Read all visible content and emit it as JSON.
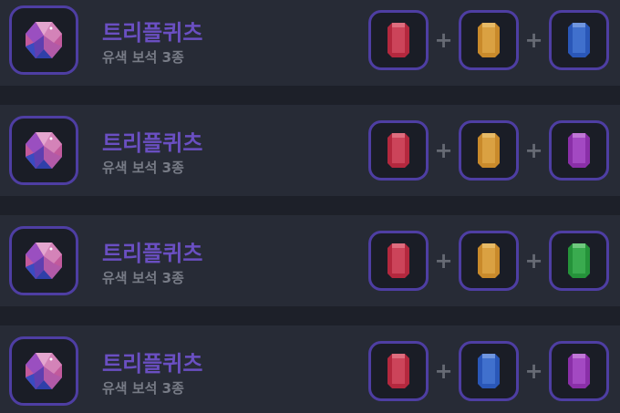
{
  "items": [
    {
      "name": "트리플퀴츠",
      "description": "유색 보석 3종",
      "icon": "triple-quartz-gem-icon",
      "ingredients": [
        {
          "icon": "red-gem-icon",
          "color": "#b4283e"
        },
        {
          "icon": "orange-gem-icon",
          "color": "#c98a2b"
        },
        {
          "icon": "blue-gem-icon",
          "color": "#2a57b8"
        }
      ]
    },
    {
      "name": "트리플퀴츠",
      "description": "유색 보석 3종",
      "icon": "triple-quartz-gem-icon",
      "ingredients": [
        {
          "icon": "red-gem-icon",
          "color": "#b4283e"
        },
        {
          "icon": "orange-gem-icon",
          "color": "#c98a2b"
        },
        {
          "icon": "purple-gem-icon",
          "color": "#8a2fa8"
        }
      ]
    },
    {
      "name": "트리플퀴츠",
      "description": "유색 보석 3종",
      "icon": "triple-quartz-gem-icon",
      "ingredients": [
        {
          "icon": "red-gem-icon",
          "color": "#b4283e"
        },
        {
          "icon": "orange-gem-icon",
          "color": "#c98a2b"
        },
        {
          "icon": "green-gem-icon",
          "color": "#25933a"
        }
      ]
    },
    {
      "name": "트리플퀴츠",
      "description": "유색 보석 3종",
      "icon": "triple-quartz-gem-icon",
      "ingredients": [
        {
          "icon": "red-gem-icon",
          "color": "#b4283e"
        },
        {
          "icon": "blue-gem-icon",
          "color": "#2a57b8"
        },
        {
          "icon": "purple-gem-icon",
          "color": "#8a2fa8"
        }
      ]
    }
  ],
  "plus_symbol": "+",
  "colors": {
    "accent": "#6a4fc2",
    "frame": "#4e3ea3",
    "row_bg": "#272b36",
    "page_bg": "#1d2029"
  }
}
